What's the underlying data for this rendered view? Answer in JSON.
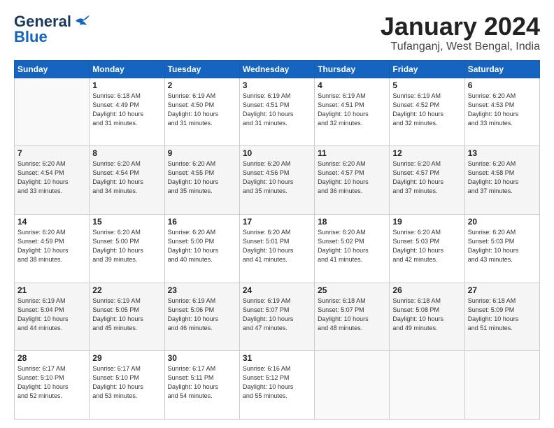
{
  "header": {
    "logo_line1": "General",
    "logo_line2": "Blue",
    "title": "January 2024",
    "location": "Tufanganj, West Bengal, India"
  },
  "weekdays": [
    "Sunday",
    "Monday",
    "Tuesday",
    "Wednesday",
    "Thursday",
    "Friday",
    "Saturday"
  ],
  "weeks": [
    [
      {
        "day": "",
        "info": ""
      },
      {
        "day": "1",
        "info": "Sunrise: 6:18 AM\nSunset: 4:49 PM\nDaylight: 10 hours\nand 31 minutes."
      },
      {
        "day": "2",
        "info": "Sunrise: 6:19 AM\nSunset: 4:50 PM\nDaylight: 10 hours\nand 31 minutes."
      },
      {
        "day": "3",
        "info": "Sunrise: 6:19 AM\nSunset: 4:51 PM\nDaylight: 10 hours\nand 31 minutes."
      },
      {
        "day": "4",
        "info": "Sunrise: 6:19 AM\nSunset: 4:51 PM\nDaylight: 10 hours\nand 32 minutes."
      },
      {
        "day": "5",
        "info": "Sunrise: 6:19 AM\nSunset: 4:52 PM\nDaylight: 10 hours\nand 32 minutes."
      },
      {
        "day": "6",
        "info": "Sunrise: 6:20 AM\nSunset: 4:53 PM\nDaylight: 10 hours\nand 33 minutes."
      }
    ],
    [
      {
        "day": "7",
        "info": "Sunrise: 6:20 AM\nSunset: 4:54 PM\nDaylight: 10 hours\nand 33 minutes."
      },
      {
        "day": "8",
        "info": "Sunrise: 6:20 AM\nSunset: 4:54 PM\nDaylight: 10 hours\nand 34 minutes."
      },
      {
        "day": "9",
        "info": "Sunrise: 6:20 AM\nSunset: 4:55 PM\nDaylight: 10 hours\nand 35 minutes."
      },
      {
        "day": "10",
        "info": "Sunrise: 6:20 AM\nSunset: 4:56 PM\nDaylight: 10 hours\nand 35 minutes."
      },
      {
        "day": "11",
        "info": "Sunrise: 6:20 AM\nSunset: 4:57 PM\nDaylight: 10 hours\nand 36 minutes."
      },
      {
        "day": "12",
        "info": "Sunrise: 6:20 AM\nSunset: 4:57 PM\nDaylight: 10 hours\nand 37 minutes."
      },
      {
        "day": "13",
        "info": "Sunrise: 6:20 AM\nSunset: 4:58 PM\nDaylight: 10 hours\nand 37 minutes."
      }
    ],
    [
      {
        "day": "14",
        "info": "Sunrise: 6:20 AM\nSunset: 4:59 PM\nDaylight: 10 hours\nand 38 minutes."
      },
      {
        "day": "15",
        "info": "Sunrise: 6:20 AM\nSunset: 5:00 PM\nDaylight: 10 hours\nand 39 minutes."
      },
      {
        "day": "16",
        "info": "Sunrise: 6:20 AM\nSunset: 5:00 PM\nDaylight: 10 hours\nand 40 minutes."
      },
      {
        "day": "17",
        "info": "Sunrise: 6:20 AM\nSunset: 5:01 PM\nDaylight: 10 hours\nand 41 minutes."
      },
      {
        "day": "18",
        "info": "Sunrise: 6:20 AM\nSunset: 5:02 PM\nDaylight: 10 hours\nand 41 minutes."
      },
      {
        "day": "19",
        "info": "Sunrise: 6:20 AM\nSunset: 5:03 PM\nDaylight: 10 hours\nand 42 minutes."
      },
      {
        "day": "20",
        "info": "Sunrise: 6:20 AM\nSunset: 5:03 PM\nDaylight: 10 hours\nand 43 minutes."
      }
    ],
    [
      {
        "day": "21",
        "info": "Sunrise: 6:19 AM\nSunset: 5:04 PM\nDaylight: 10 hours\nand 44 minutes."
      },
      {
        "day": "22",
        "info": "Sunrise: 6:19 AM\nSunset: 5:05 PM\nDaylight: 10 hours\nand 45 minutes."
      },
      {
        "day": "23",
        "info": "Sunrise: 6:19 AM\nSunset: 5:06 PM\nDaylight: 10 hours\nand 46 minutes."
      },
      {
        "day": "24",
        "info": "Sunrise: 6:19 AM\nSunset: 5:07 PM\nDaylight: 10 hours\nand 47 minutes."
      },
      {
        "day": "25",
        "info": "Sunrise: 6:18 AM\nSunset: 5:07 PM\nDaylight: 10 hours\nand 48 minutes."
      },
      {
        "day": "26",
        "info": "Sunrise: 6:18 AM\nSunset: 5:08 PM\nDaylight: 10 hours\nand 49 minutes."
      },
      {
        "day": "27",
        "info": "Sunrise: 6:18 AM\nSunset: 5:09 PM\nDaylight: 10 hours\nand 51 minutes."
      }
    ],
    [
      {
        "day": "28",
        "info": "Sunrise: 6:17 AM\nSunset: 5:10 PM\nDaylight: 10 hours\nand 52 minutes."
      },
      {
        "day": "29",
        "info": "Sunrise: 6:17 AM\nSunset: 5:10 PM\nDaylight: 10 hours\nand 53 minutes."
      },
      {
        "day": "30",
        "info": "Sunrise: 6:17 AM\nSunset: 5:11 PM\nDaylight: 10 hours\nand 54 minutes."
      },
      {
        "day": "31",
        "info": "Sunrise: 6:16 AM\nSunset: 5:12 PM\nDaylight: 10 hours\nand 55 minutes."
      },
      {
        "day": "",
        "info": ""
      },
      {
        "day": "",
        "info": ""
      },
      {
        "day": "",
        "info": ""
      }
    ]
  ]
}
